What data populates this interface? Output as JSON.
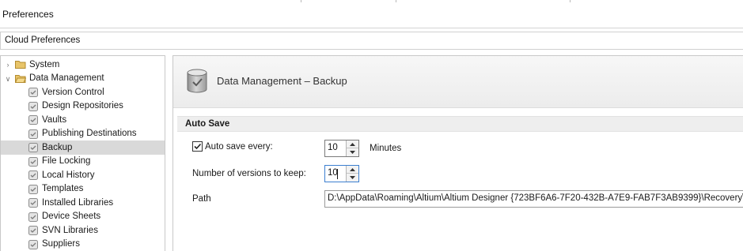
{
  "window": {
    "title": "Preferences"
  },
  "cloud_preferences": {
    "label": "Cloud Preferences"
  },
  "tree": {
    "groups": [
      {
        "label": "System",
        "expanded": false
      },
      {
        "label": "Data Management",
        "expanded": true
      }
    ],
    "items": [
      {
        "label": "Version Control",
        "selected": false
      },
      {
        "label": "Design Repositories",
        "selected": false
      },
      {
        "label": "Vaults",
        "selected": false
      },
      {
        "label": "Publishing Destinations",
        "selected": false
      },
      {
        "label": "Backup",
        "selected": true
      },
      {
        "label": "File Locking",
        "selected": false
      },
      {
        "label": "Local History",
        "selected": false
      },
      {
        "label": "Templates",
        "selected": false
      },
      {
        "label": "Installed Libraries",
        "selected": false
      },
      {
        "label": "Device Sheets",
        "selected": false
      },
      {
        "label": "SVN Libraries",
        "selected": false
      },
      {
        "label": "Suppliers",
        "selected": false
      }
    ]
  },
  "page": {
    "title": "Data Management – Backup",
    "section": "Auto Save",
    "auto_save": {
      "checked": true,
      "label": "Auto save every:",
      "value": "10",
      "unit": "Minutes"
    },
    "versions": {
      "label": "Number of versions to keep:",
      "value": "10"
    },
    "path": {
      "label": "Path",
      "value": "D:\\AppData\\Roaming\\Altium\\Altium Designer {723BF6A6-7F20-432B-A7E9-FAB7F3AB9399}\\Recovery\\"
    }
  },
  "colors": {
    "selection": "#d9d9d9",
    "folder": "#e8c469",
    "focus_border": "#3c7fd0"
  }
}
